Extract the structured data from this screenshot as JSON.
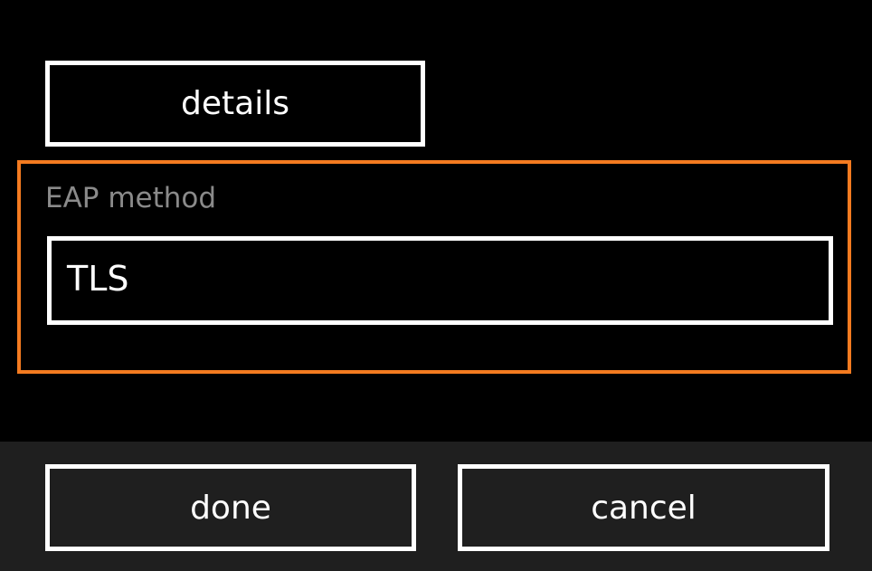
{
  "details_button": {
    "label": "details"
  },
  "eap": {
    "label": "EAP method",
    "selected_value": "TLS",
    "accent_color": "#f47b20"
  },
  "app_bar": {
    "done_label": "done",
    "cancel_label": "cancel"
  }
}
